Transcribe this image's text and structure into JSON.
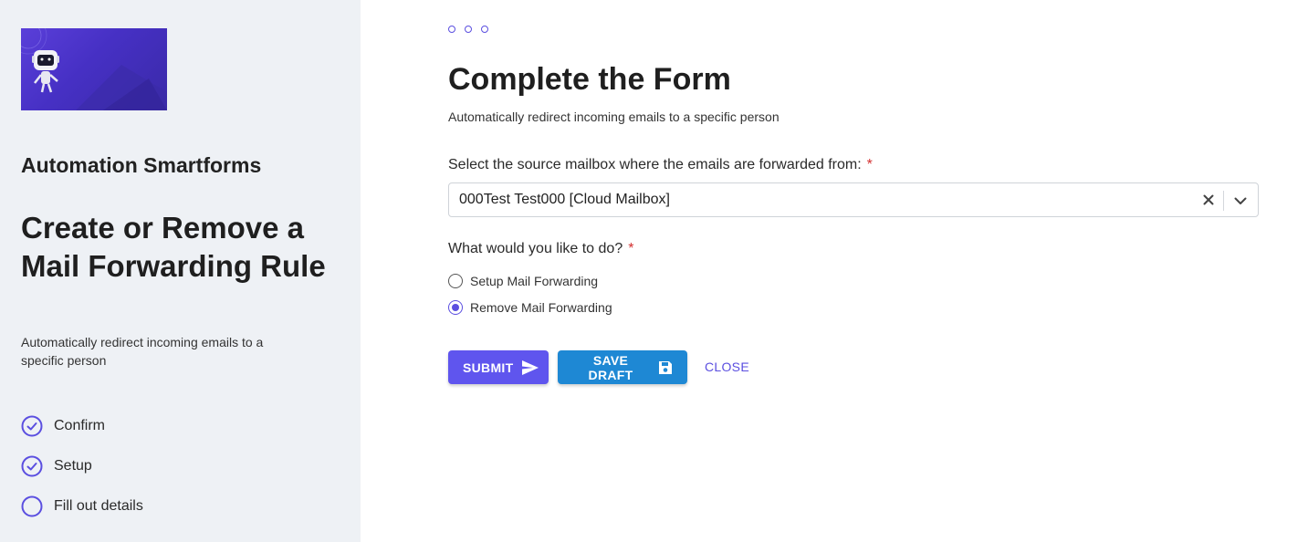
{
  "sidebar": {
    "brand": "Automation Smartforms",
    "title": "Create or Remove a Mail Forwarding Rule",
    "description": "Automatically redirect incoming emails to a specific person",
    "steps": [
      {
        "label": "Confirm",
        "status": "complete"
      },
      {
        "label": "Setup",
        "status": "complete"
      },
      {
        "label": "Fill out details",
        "status": "current"
      }
    ]
  },
  "main": {
    "title": "Complete the Form",
    "description": "Automatically redirect incoming emails to a specific person",
    "source_mailbox": {
      "label": "Select the source mailbox where the emails are forwarded from:",
      "required_mark": "*",
      "value": "000Test Test000 [Cloud Mailbox]"
    },
    "action": {
      "label": "What would you like to do?",
      "required_mark": "*",
      "options": [
        {
          "label": "Setup Mail Forwarding",
          "checked": false
        },
        {
          "label": "Remove Mail Forwarding",
          "checked": true
        }
      ]
    },
    "buttons": {
      "submit": "SUBMIT",
      "save_draft": "SAVE DRAFT",
      "close": "CLOSE"
    }
  },
  "colors": {
    "accent": "#5f55ee",
    "draft": "#1e88d4",
    "sidebar_bg": "#eef1f5",
    "required": "#d32f2f"
  }
}
